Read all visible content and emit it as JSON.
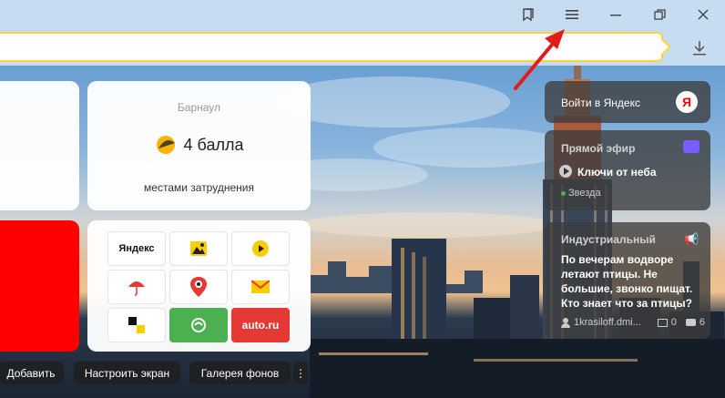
{
  "toolbar": {
    "bookmarks_icon": "bookmarks-icon",
    "menu_icon": "hamburger-menu-icon",
    "minimize_icon": "minimize-icon",
    "restore_icon": "restore-icon",
    "close_icon": "close-icon",
    "download_icon": "download-icon"
  },
  "address_bar": {
    "value": "",
    "placeholder": ""
  },
  "weather": {
    "city": "Барнаул",
    "score": "4 балла",
    "description": "местами затруднения"
  },
  "apps": [
    {
      "label": "Яндекс",
      "icon": "yandex-wordmark"
    },
    {
      "label": "",
      "icon": "images-icon"
    },
    {
      "label": "",
      "icon": "video-play-icon"
    },
    {
      "label": "",
      "icon": "umbrella-icon"
    },
    {
      "label": "",
      "icon": "maps-pin-icon"
    },
    {
      "label": "",
      "icon": "mail-envelope-icon"
    },
    {
      "label": "",
      "icon": "zen-icon"
    },
    {
      "label": "",
      "icon": "market-icon"
    },
    {
      "label": "auto.ru",
      "icon": "auto-ru-logo"
    }
  ],
  "bottom_bar": {
    "add": "Добавить",
    "customize": "Настроить экран",
    "gallery": "Галерея фонов",
    "more": "⋮"
  },
  "right_panel": {
    "login": {
      "label": "Войти в Яндекс",
      "badge": "Я"
    },
    "live": {
      "header": "Прямой эфир",
      "title": "Ключи от неба",
      "channel": "Звезда"
    },
    "post": {
      "header": "Индустриальный",
      "body": "По вечерам водворе летают птицы. Не большие, звонко пищат. Кто знает что за птицы?",
      "author": "1krasiloff.dmi...",
      "images": "0",
      "comments": "6"
    }
  },
  "colors": {
    "accent_yellow": "#ffd43b",
    "brand_red": "#ff0000",
    "annotation_red": "#e21b1b"
  }
}
